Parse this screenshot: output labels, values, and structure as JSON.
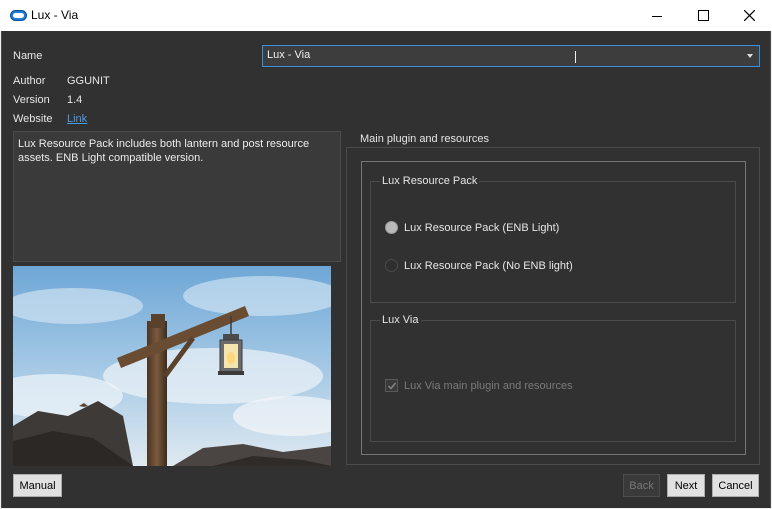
{
  "window": {
    "title": "Lux - Via"
  },
  "fields": {
    "name_label": "Name",
    "name_value": "Lux - Via",
    "author_label": "Author",
    "author_value": "GGUNIT",
    "version_label": "Version",
    "version_value": "1.4",
    "website_label": "Website",
    "website_link": "Link"
  },
  "description": "Lux Resource Pack includes both lantern and post resource assets. ENB Light compatible version.",
  "main_group": {
    "title": "Main plugin and resources",
    "resource_pack": {
      "title": "Lux Resource Pack",
      "options": [
        {
          "label": "Lux Resource Pack (ENB Light)",
          "selected": true
        },
        {
          "label": "Lux Resource Pack (No ENB light)",
          "selected": false
        }
      ]
    },
    "lux_via": {
      "title": "Lux Via",
      "checkbox_label": "Lux Via main plugin and resources",
      "checked": true,
      "enabled": false
    }
  },
  "buttons": {
    "manual": "Manual",
    "back": "Back",
    "next": "Next",
    "cancel": "Cancel"
  },
  "icons": {
    "app": "pill-icon",
    "minimize": "minimize-icon",
    "maximize": "maximize-icon",
    "close": "close-icon"
  },
  "colors": {
    "background": "#313131",
    "accent": "#3a8fd9",
    "link": "#4a9de8"
  }
}
